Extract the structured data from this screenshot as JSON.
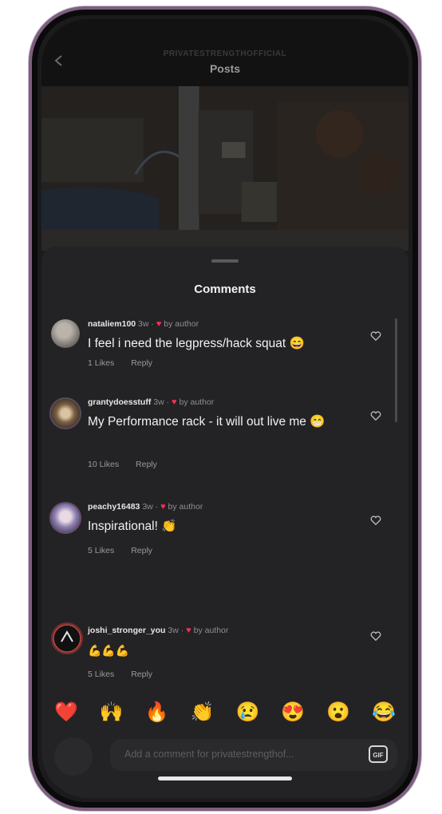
{
  "header": {
    "account": "PRIVATESTRENGTHOFFICIAL",
    "title": "Posts"
  },
  "sheet": {
    "title": "Comments"
  },
  "comments": [
    {
      "username": "nataliem100",
      "time": "3w",
      "author_tag": "by author",
      "text": "I feel i need the legpress/hack squat 😄",
      "likes": "1 Likes",
      "reply": "Reply"
    },
    {
      "username": "grantydoesstuff",
      "time": "3w",
      "author_tag": "by author",
      "text": "My Performance rack - it will out live me 😁",
      "likes": "10 Likes",
      "reply": "Reply"
    },
    {
      "username": "peachy16483",
      "time": "3w",
      "author_tag": "by author",
      "text": "Inspirational! 👏",
      "likes": "5 Likes",
      "reply": "Reply"
    },
    {
      "username": "joshi_stronger_you",
      "time": "3w",
      "author_tag": "by author",
      "text": "💪💪💪",
      "likes": "5 Likes",
      "reply": "Reply"
    }
  ],
  "quick_reactions": [
    "❤️",
    "🙌",
    "🔥",
    "👏",
    "😢",
    "😍",
    "😮",
    "😂"
  ],
  "composer": {
    "placeholder": "Add a comment for privatestrengthof...",
    "gif_label": "GIF"
  },
  "colors": {
    "sheet_bg": "#232325",
    "accent_heart": "#ff2d55",
    "frame": "#7c5f7e"
  }
}
